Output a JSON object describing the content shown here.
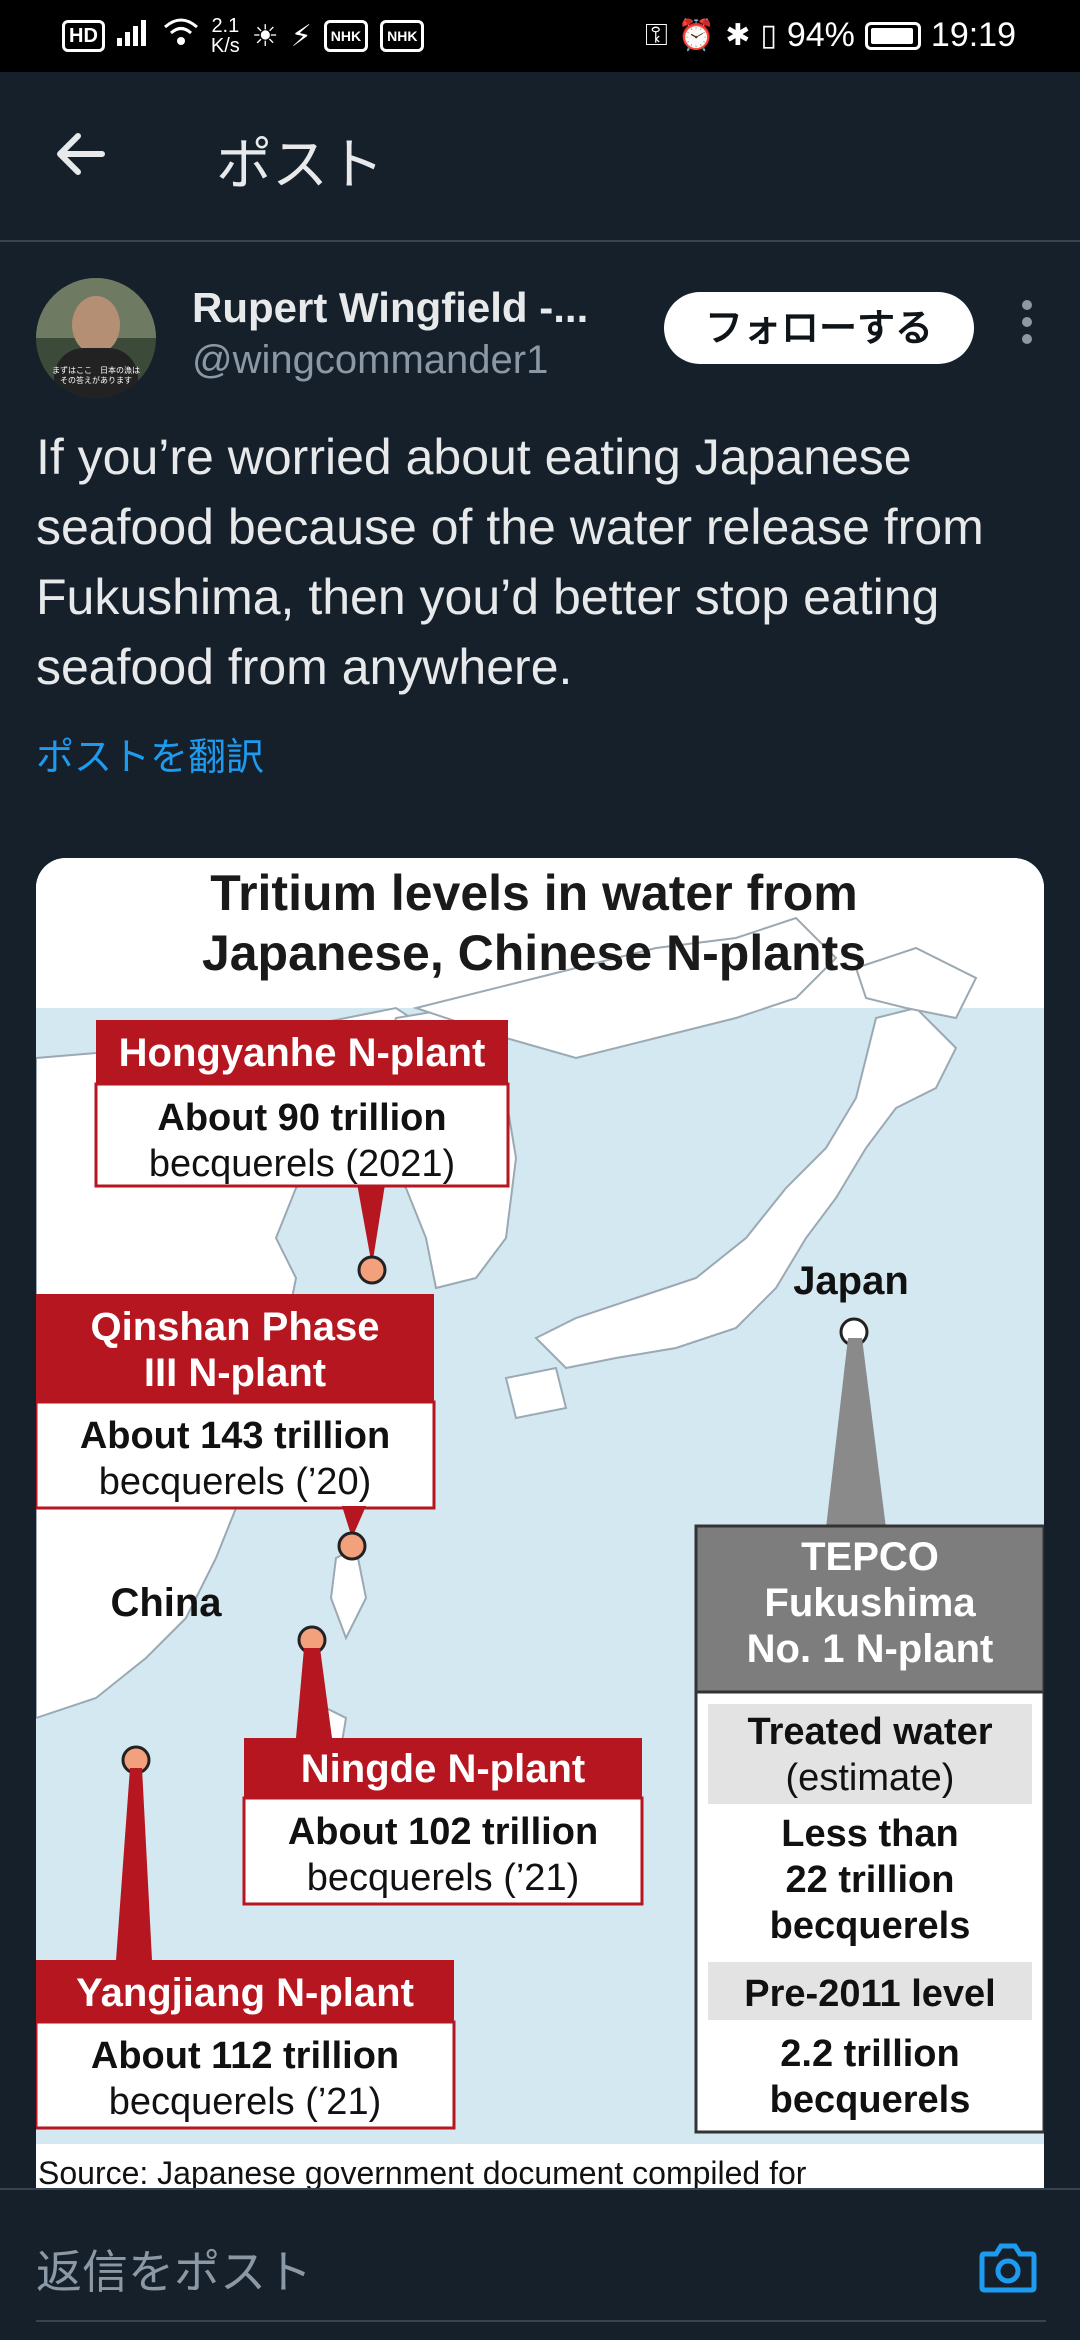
{
  "status_bar": {
    "hd": "HD",
    "net_speed_value": "2.1",
    "net_speed_unit": "K/s",
    "nhk_1": "NHK",
    "nhk_2": "NHK",
    "battery": "94%",
    "time": "19:19"
  },
  "app_bar": {
    "title": "ポスト"
  },
  "post": {
    "author_name": "Rupert Wingfield -...",
    "handle": "@wingcommander1",
    "follow_label": "フォローする",
    "avatar_caption_1": "まずはここ　日本の漁は",
    "avatar_caption_2": "その答えがあります",
    "text": "If you’re worried about eating Japanese seafood because of the water release from Fukushima, then you’d better stop eating seafood from anywhere.",
    "translate_label": "ポストを翻訳"
  },
  "media": {
    "title_1": "Tritium levels in water from",
    "title_2": "Japanese, Chinese N-plants",
    "label_japan": "Japan",
    "label_china": "China",
    "hongyanhe": {
      "name": "Hongyanhe N-plant",
      "line1": "About 90 trillion",
      "line2": "becquerels (2021)"
    },
    "qinshan": {
      "name1": "Qinshan Phase",
      "name2": "III N-plant",
      "line1": "About 143 trillion",
      "line2": "becquerels (’20)"
    },
    "ningde": {
      "name": "Ningde N-plant",
      "line1": "About 102 trillion",
      "line2": "becquerels (’21)"
    },
    "yangjiang": {
      "name": "Yangjiang N-plant",
      "line1": "About 112 trillion",
      "line2": "becquerels (’21)"
    },
    "tepco": {
      "name1": "TEPCO",
      "name2": "Fukushima",
      "name3": "No. 1 N-plant",
      "treated1": "Treated water",
      "treated2": "(estimate)",
      "less1": "Less than",
      "less2": "22 trillion",
      "less3": "becquerels",
      "pre": "Pre-2011 level",
      "pre1": "2.2 trillion",
      "pre2": "becquerels"
    },
    "source": "Source: Japanese government document compiled for"
  },
  "reply": {
    "placeholder": "返信をポスト"
  },
  "colors": {
    "background": "#15202b",
    "accent": "#1d9bf0",
    "plant_label_red": "#b5161f",
    "tepco_gray": "#7d7d7d"
  }
}
